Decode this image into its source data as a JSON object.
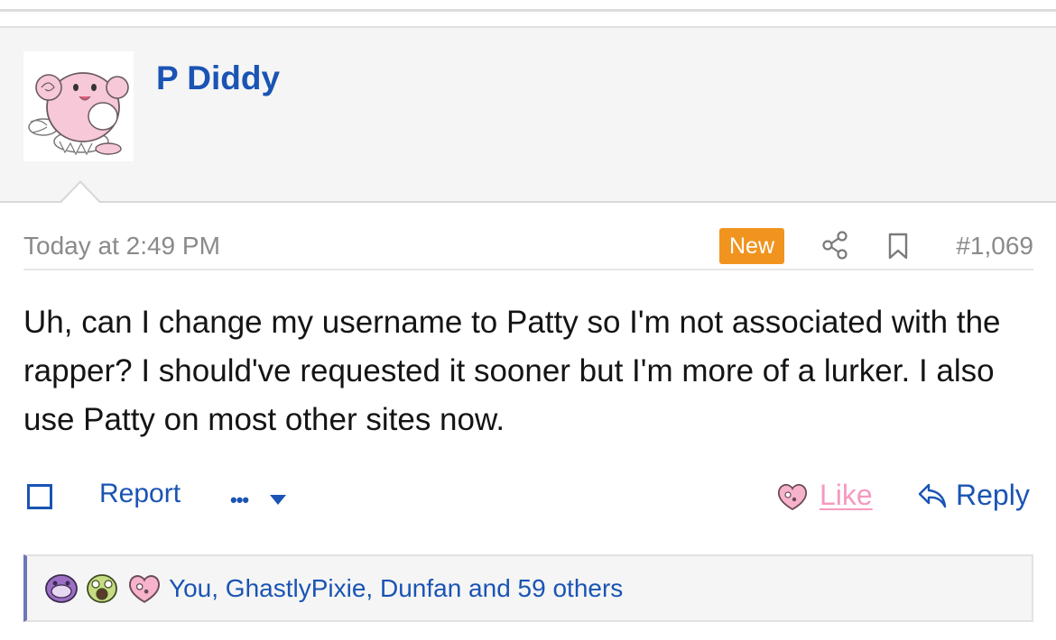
{
  "post": {
    "username": "P Diddy",
    "timestamp": "Today at 2:49 PM",
    "new_badge": "New",
    "post_number": "#1,069",
    "message": "Uh, can I change my username to Patty so I'm not associated with the rapper? I should've requested it sooner but I'm more of a lurker. I also use Patty on most other sites now."
  },
  "actions": {
    "report_label": "Report",
    "more_label": "•••",
    "like_label": "Like",
    "reply_label": "Reply"
  },
  "reactions": {
    "summary": "You, GhastlyPixie, Dunfan and 59 others",
    "icons": [
      "purple-blob-reaction-icon",
      "green-shocked-reaction-icon",
      "pink-heart-reaction-icon"
    ]
  },
  "colors": {
    "link_blue": "#1a54b4",
    "new_badge": "#f0941f",
    "like_pink": "#f59ac0",
    "reactions_accent": "#6e76b8"
  }
}
